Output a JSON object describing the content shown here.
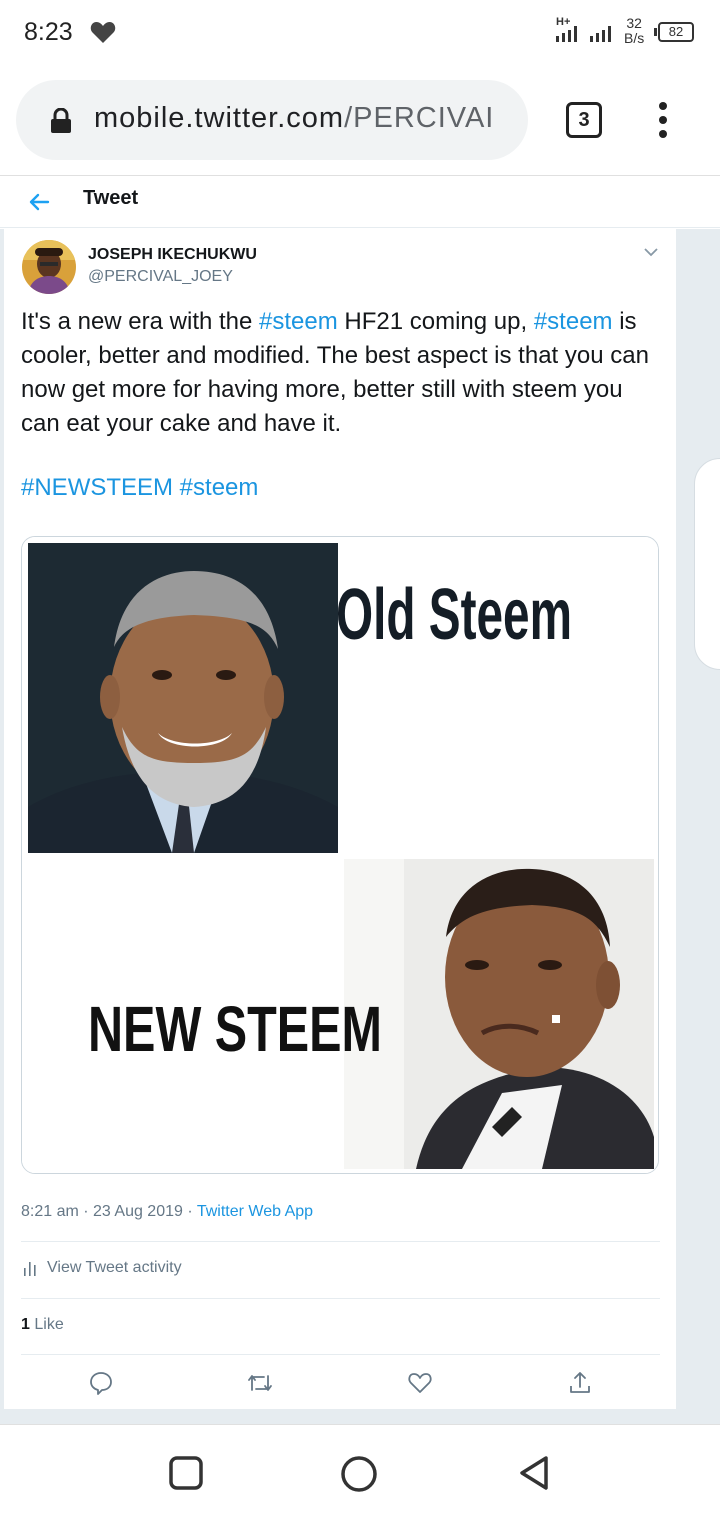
{
  "status_bar": {
    "time": "8:23",
    "network": "H+",
    "speed_value": "32",
    "speed_unit": "B/s",
    "battery": "82"
  },
  "browser": {
    "url_domain": "mobile.twitter.com",
    "url_path": "/PERCIVAI",
    "tab_count": "3"
  },
  "header": {
    "title": "Tweet"
  },
  "tweet": {
    "display_name": "JOSEPH IKECHUKWU",
    "handle": "@PERCIVAL_JOEY",
    "text_parts": [
      "It's a new era with the ",
      "#steem",
      " HF21 coming up, ",
      "#steem",
      " is cooler, better and modified. The best aspect is that you can now get more for having more, better still with steem you can eat your cake and have it."
    ],
    "hashtags": "#NEWSTEEM #steem",
    "media": {
      "top_caption": "Old Steem",
      "bottom_caption": "NEW STEEM"
    },
    "time": "8:21 am",
    "date": "23 Aug 2019",
    "source": "Twitter Web App",
    "activity_label": "View Tweet activity",
    "like_count": "1",
    "like_label": "Like"
  },
  "colors": {
    "link": "#1b95e0",
    "muted": "#657786",
    "text": "#14171a",
    "divider": "#e6ecf0"
  }
}
